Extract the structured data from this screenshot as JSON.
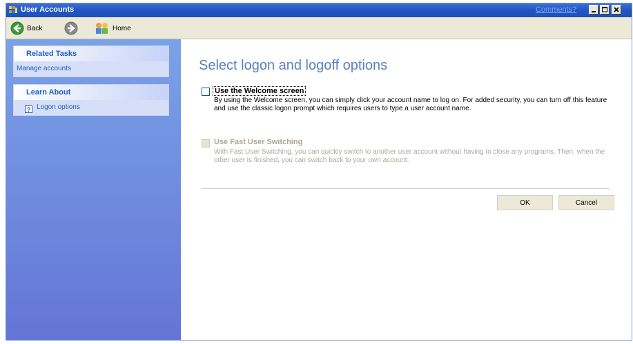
{
  "window": {
    "title": "User Accounts",
    "comments_link": "Comments?"
  },
  "toolbar": {
    "back_label": "Back",
    "home_label": "Home"
  },
  "sidebar": {
    "related_tasks": {
      "title": "Related Tasks",
      "items": [
        {
          "label": "Manage accounts"
        }
      ]
    },
    "learn_about": {
      "title": "Learn About",
      "items": [
        {
          "label": "Logon options",
          "icon": "help-icon"
        }
      ]
    }
  },
  "main": {
    "title": "Select logon and logoff options",
    "options": [
      {
        "label": "Use the Welcome screen",
        "checked": false,
        "enabled": true,
        "description": "By using the Welcome screen, you can simply click your account name to log on. For added security, you can turn off this feature and use the classic logon prompt which requires users to type a user account name."
      },
      {
        "label": "Use Fast User Switching",
        "checked": false,
        "enabled": false,
        "description": "With Fast User Switching, you can quickly switch to another user account without having to close any programs. Then, when the other user is finished, you can switch back to your own account."
      }
    ],
    "ok_label": "OK",
    "cancel_label": "Cancel"
  },
  "colors": {
    "titlebar": "#2157c4",
    "sidebar": "#7ba2e7",
    "task_link": "#215dc6",
    "page_title": "#5a7ebf"
  }
}
